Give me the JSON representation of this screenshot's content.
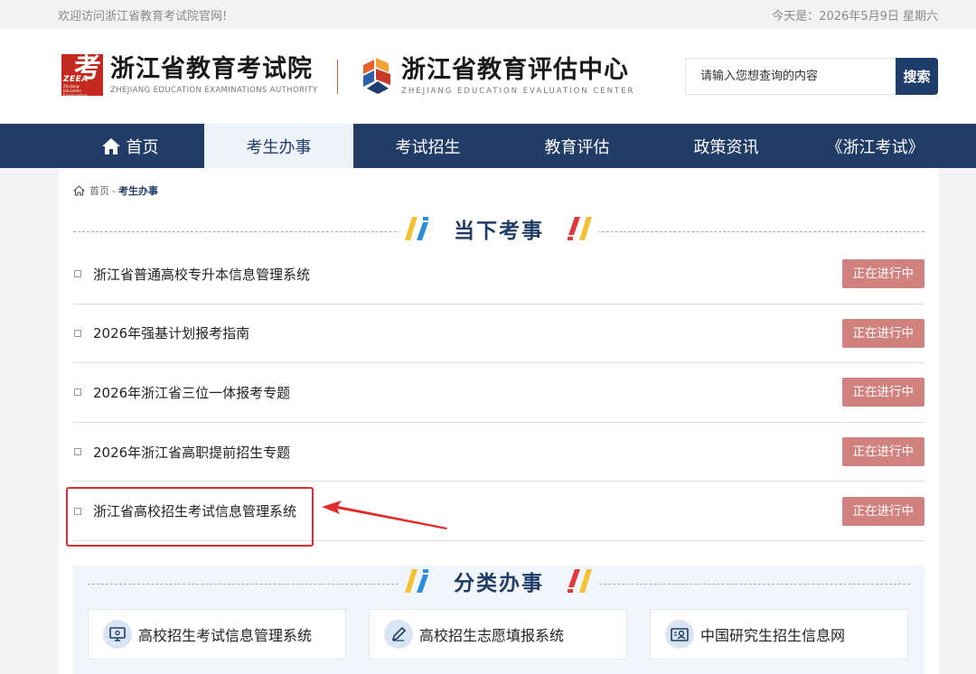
{
  "topbar": {
    "welcome": "欢迎访问浙江省教育考试院官网!",
    "date": "今天是：2026年5月9日 星期六"
  },
  "header": {
    "logo1": {
      "mark_char": "考",
      "mark_abbr": "ZEEA",
      "mark_small": "Zhejiang Education Examinations Authority",
      "name_cn": "浙江省教育考试院",
      "name_en": "ZHEJIANG EDUCATION EXAMINATIONS AUTHORITY"
    },
    "logo2": {
      "name_cn": "浙江省教育评估中心",
      "name_en": "ZHEJIANG EDUCATION EVALUATION CENTER"
    },
    "search": {
      "placeholder": "请输入您想查询的内容",
      "button": "搜索"
    }
  },
  "nav": {
    "items": [
      {
        "label": "首页",
        "icon": "home-icon"
      },
      {
        "label": "考生办事",
        "active": true
      },
      {
        "label": "考试招生"
      },
      {
        "label": "教育评估"
      },
      {
        "label": "政策资讯"
      },
      {
        "label": "《浙江考试》"
      }
    ]
  },
  "breadcrumb": {
    "home": "首页",
    "separator": "-",
    "current": "考生办事"
  },
  "current": {
    "title": "当下考事",
    "items": [
      {
        "title": "浙江省普通高校专升本信息管理系统",
        "status": "正在进行中"
      },
      {
        "title": "2026年强基计划报考指南",
        "status": "正在进行中"
      },
      {
        "title": "2026年浙江省三位一体报考专题",
        "status": "正在进行中"
      },
      {
        "title": "2026年浙江省高职提前招生专题",
        "status": "正在进行中"
      },
      {
        "title": "浙江省高校招生考试信息管理系统",
        "status": "正在进行中"
      }
    ]
  },
  "category": {
    "title": "分类办事",
    "items": [
      {
        "label": "高校招生考试信息管理系统",
        "icon": "computer-icon"
      },
      {
        "label": "高校招生志愿填报系统",
        "icon": "pencil-icon"
      },
      {
        "label": "中国研究生招生信息网",
        "icon": "user-card-icon"
      }
    ]
  },
  "colors": {
    "nav_bg": "#213c66",
    "badge": "#d2827e",
    "highlight": "#e22b2b",
    "brand_red": "#c4291f"
  }
}
